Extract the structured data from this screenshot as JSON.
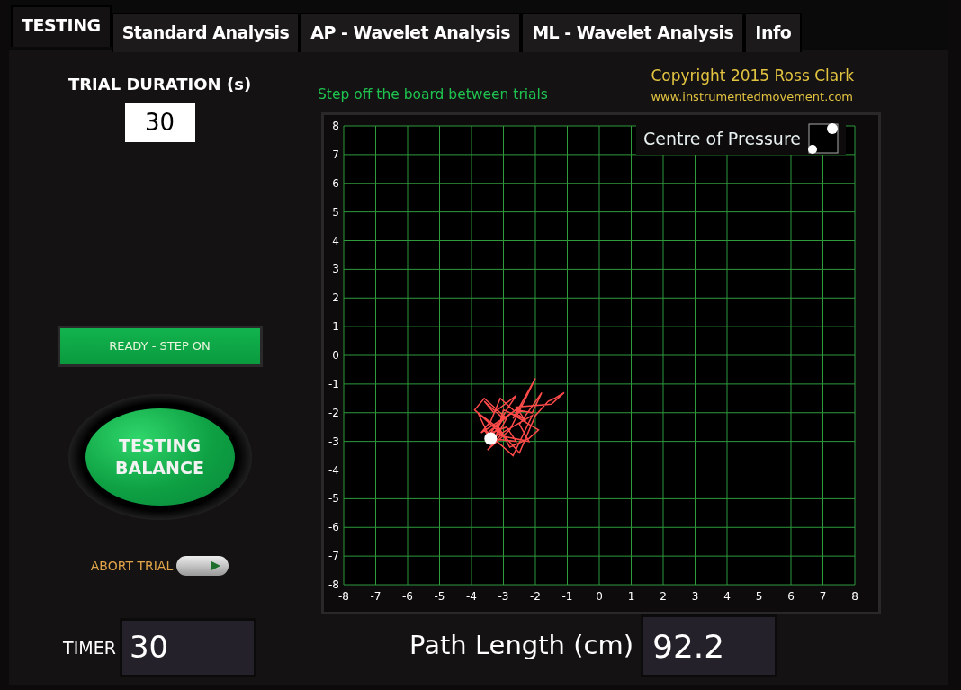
{
  "tabs": [
    {
      "label": "TESTING",
      "selected": true
    },
    {
      "label": "Standard Analysis",
      "selected": false
    },
    {
      "label": "AP - Wavelet Analysis",
      "selected": false
    },
    {
      "label": "ML - Wavelet Analysis",
      "selected": false
    },
    {
      "label": "Info",
      "selected": false
    }
  ],
  "trial_duration": {
    "label": "TRIAL DURATION (s)",
    "value": "30"
  },
  "instruction": "Step off the board between trials",
  "copyright": {
    "line": "Copyright 2015 Ross Clark",
    "url": "www.instrumentedmovement.com"
  },
  "status_indicator": {
    "label": "READY - STEP ON",
    "on": true
  },
  "test_button": {
    "label": "TESTING BALANCE",
    "on": true
  },
  "abort_trial": {
    "label": "ABORT TRIAL",
    "on": false
  },
  "timer": {
    "label": "TIMER",
    "value": "30"
  },
  "plot": {
    "legend": "Centre of Pressure",
    "chart_data": {
      "type": "line",
      "grid": true,
      "xlim": [
        -8,
        8
      ],
      "ylim": [
        -8,
        8
      ],
      "xticks": [
        -8,
        -7,
        -6,
        -5,
        -4,
        -3,
        -2,
        -1,
        0,
        1,
        2,
        3,
        4,
        5,
        6,
        7,
        8
      ],
      "yticks": [
        -8,
        -7,
        -6,
        -5,
        -4,
        -3,
        -2,
        -1,
        0,
        1,
        2,
        3,
        4,
        5,
        6,
        7,
        8
      ]
    }
  },
  "path_length": {
    "label": "Path Length (cm)",
    "value": "92.2"
  }
}
